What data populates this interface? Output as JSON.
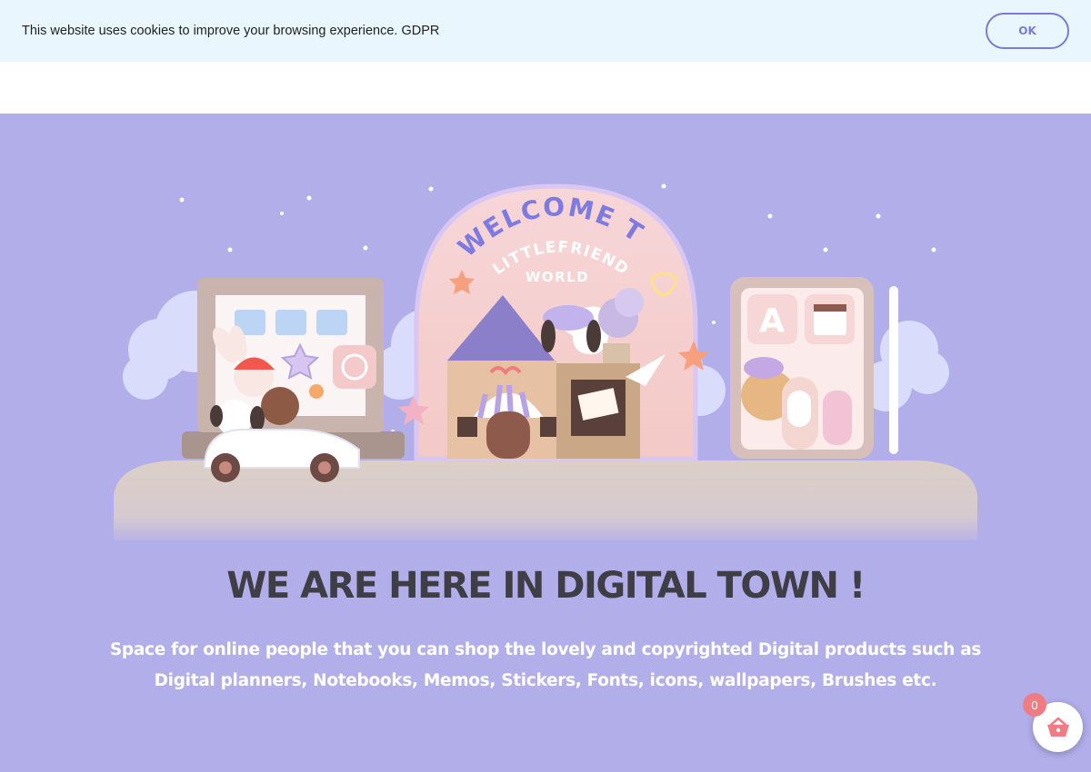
{
  "cookie": {
    "message": "This website uses cookies to improve your browsing experience. GDPR",
    "ok_label": "OK"
  },
  "hero": {
    "arch_line1": "WELCOME TO",
    "arch_line2": "LITTLEFRIEND",
    "arch_line3": "WORLD",
    "tile_letter": "A",
    "headline": "WE ARE HERE IN DIGITAL TOWN !",
    "tagline": "Space for online people that you can shop the lovely and copyrighted Digital products such as Digital planners, Notebooks, Memos, Stickers,  Fonts, icons, wallpapers, Brushes etc."
  },
  "cart": {
    "count": "0",
    "icon": "basket-icon"
  },
  "colors": {
    "hero_bg": "#b1aeea",
    "accent": "#7b7bd6",
    "badge": "#f07c83",
    "headline": "#3f3d45"
  }
}
